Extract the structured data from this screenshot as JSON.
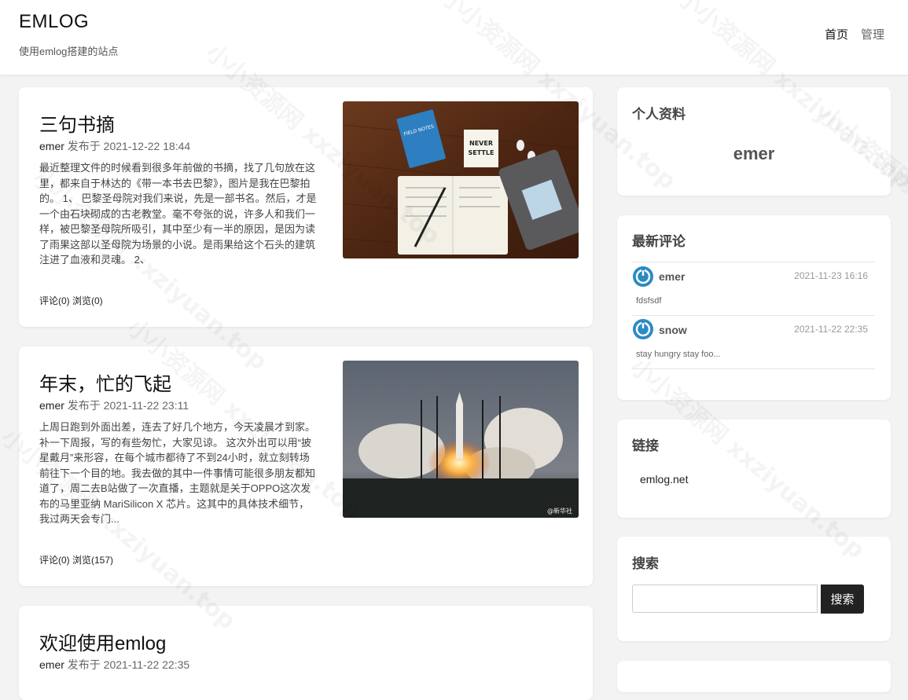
{
  "site": {
    "title": "EMLOG",
    "subtitle": "使用emlog搭建的站点"
  },
  "nav": {
    "items": [
      {
        "label": "首页"
      },
      {
        "label": "管理"
      }
    ]
  },
  "posts": [
    {
      "title": "三句书摘",
      "author": "emer",
      "meta": "发布于 2021-12-22 18:44",
      "excerpt": "最近整理文件的时候看到很多年前做的书摘，找了几句放在这里，都来自于林达的《带一本书去巴黎》，图片是我在巴黎拍的。 1、 巴黎圣母院对我们来说，先是一部书名。然后，才是一个由石块砌成的古老教堂。毫不夸张的说，许多人和我们一样，被巴黎圣母院所吸引，其中至少有一半的原因，是因为读了雨果这部以圣母院为场景的小说。是雨果给这个石头的建筑注进了血液和灵魂。 2、",
      "stats": "评论(0) 浏览(0)"
    },
    {
      "title": "年末，忙的飞起",
      "author": "emer",
      "meta": "发布于 2021-11-22 23:11",
      "excerpt": "上周日跑到外面出差，连去了好几个地方，今天凌晨才到家。补一下周报，写的有些匆忙，大家见谅。 这次外出可以用“披星戴月”来形容，在每个城市都待了不到24小时，就立刻转场前往下一个目的地。我去做的其中一件事情可能很多朋友都知道了，周二去B站做了一次直播，主题就是关于OPPO这次发布的马里亚纳 MariSilicon X 芯片。这其中的具体技术细节，我过两天会专门...",
      "stats": "评论(0) 浏览(157)",
      "image_caption": "@新华社"
    },
    {
      "title": "欢迎使用emlog",
      "author": "emer",
      "meta": "发布于 2021-11-22 22:35"
    }
  ],
  "sidebar": {
    "profile": {
      "title": "个人资料",
      "name": "emer"
    },
    "comments": {
      "title": "最新评论",
      "items": [
        {
          "name": "emer",
          "time": "2021-11-23 16:16",
          "text": "fdsfsdf"
        },
        {
          "name": "snow",
          "time": "2021-11-22 22:35",
          "text": "stay hungry stay foo..."
        }
      ]
    },
    "links": {
      "title": "链接",
      "items": [
        {
          "label": "emlog.net"
        }
      ]
    },
    "search": {
      "title": "搜索",
      "button": "搜索"
    }
  },
  "notebook_labels": {
    "field_notes": "FIELD NOTES",
    "never_settle": "NEVER SETTLE"
  },
  "watermark": "小小资源网 xxziyuan.top",
  "colors": {
    "accent_avatar": "#2a8ac4",
    "button_bg": "#222222",
    "page_bg": "#f3f3f3"
  }
}
